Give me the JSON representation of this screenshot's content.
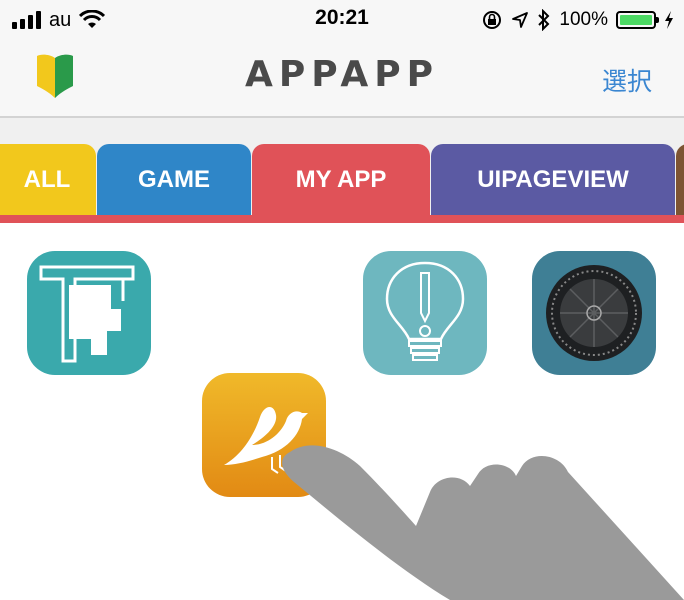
{
  "status": {
    "carrier": "au",
    "time": "20:21",
    "battery": "100%",
    "battery_level": 1.0
  },
  "nav": {
    "title": "APPAPP",
    "action": "選択"
  },
  "tabs": [
    {
      "label": "ALL",
      "color": "#f2c81c"
    },
    {
      "label": "GAME",
      "color": "#2f86c8"
    },
    {
      "label": "MY APP",
      "color": "#e05258",
      "selected": true
    },
    {
      "label": "UIPAGEVIEW",
      "color": "#5b5aa3"
    }
  ],
  "apps": [
    {
      "icon": "floorplan-icon",
      "color": "#3aa9ac"
    },
    {
      "icon": "lightbulb-icon",
      "color": "#6eb7bf"
    },
    {
      "icon": "compass-dial-icon",
      "color": "#3f7f95"
    },
    {
      "icon": "bird-icon",
      "color": "#e8a51d"
    }
  ],
  "overlay": {
    "icon": "hand-pointer-icon"
  }
}
